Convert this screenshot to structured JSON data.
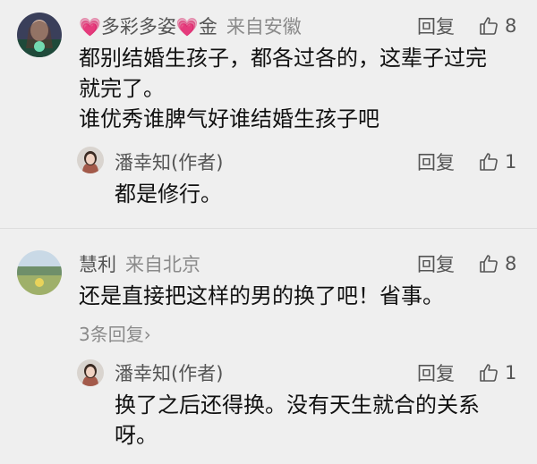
{
  "comments": [
    {
      "user": "多彩多姿",
      "heart_left": "💗",
      "heart_right": "💗",
      "suffix": "金",
      "location": "来自安徽",
      "reply_label": "回复",
      "likes": "8",
      "lines": [
        "都别结婚生孩子，都各过各的，这辈子过完",
        "就完了。",
        "谁优秀谁脾气好谁结婚生孩子吧"
      ],
      "reply": {
        "user": "潘幸知(作者)",
        "reply_label": "回复",
        "likes": "1",
        "text": "都是修行。"
      }
    },
    {
      "user": "慧利",
      "location": "来自北京",
      "reply_label": "回复",
      "likes": "8",
      "text": "还是直接把这样的男的换了吧！省事。",
      "more_replies": "3条回复",
      "more_chevron": "›",
      "reply": {
        "user": "潘幸知(作者)",
        "reply_label": "回复",
        "likes": "1",
        "lines": [
          "换了之后还得换。没有天生就合的关系",
          "呀。"
        ]
      }
    }
  ]
}
